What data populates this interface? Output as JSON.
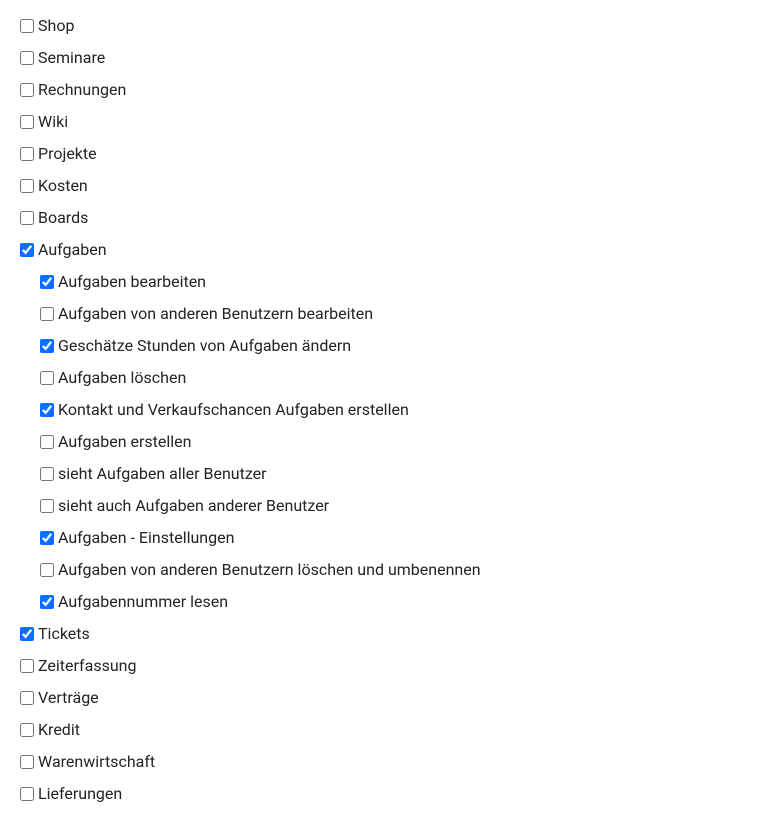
{
  "permissions": [
    {
      "id": "shop",
      "label": "Shop",
      "checked": false
    },
    {
      "id": "seminare",
      "label": "Seminare",
      "checked": false
    },
    {
      "id": "rechnungen",
      "label": "Rechnungen",
      "checked": false
    },
    {
      "id": "wiki",
      "label": "Wiki",
      "checked": false
    },
    {
      "id": "projekte",
      "label": "Projekte",
      "checked": false
    },
    {
      "id": "kosten",
      "label": "Kosten",
      "checked": false
    },
    {
      "id": "boards",
      "label": "Boards",
      "checked": false
    },
    {
      "id": "aufgaben",
      "label": "Aufgaben",
      "checked": true,
      "children": [
        {
          "id": "aufgaben-bearbeiten",
          "label": "Aufgaben bearbeiten",
          "checked": true
        },
        {
          "id": "aufgaben-andere-bearbeiten",
          "label": "Aufgaben von anderen Benutzern bearbeiten",
          "checked": false
        },
        {
          "id": "aufgaben-stunden",
          "label": "Geschätze Stunden von Aufgaben ändern",
          "checked": true
        },
        {
          "id": "aufgaben-loeschen",
          "label": "Aufgaben löschen",
          "checked": false
        },
        {
          "id": "aufgaben-kontakt",
          "label": "Kontakt und Verkaufschancen Aufgaben erstellen",
          "checked": true
        },
        {
          "id": "aufgaben-erstellen",
          "label": "Aufgaben erstellen",
          "checked": false
        },
        {
          "id": "aufgaben-sieht-alle",
          "label": "sieht Aufgaben aller Benutzer",
          "checked": false
        },
        {
          "id": "aufgaben-sieht-andere",
          "label": "sieht auch Aufgaben anderer Benutzer",
          "checked": false
        },
        {
          "id": "aufgaben-einstellungen",
          "label": "Aufgaben - Einstellungen",
          "checked": true
        },
        {
          "id": "aufgaben-andere-loeschen",
          "label": "Aufgaben von anderen Benutzern löschen und umbenennen",
          "checked": false
        },
        {
          "id": "aufgaben-nummer",
          "label": "Aufgabennummer lesen",
          "checked": true
        }
      ]
    },
    {
      "id": "tickets",
      "label": "Tickets",
      "checked": true
    },
    {
      "id": "zeiterfassung",
      "label": "Zeiterfassung",
      "checked": false
    },
    {
      "id": "vertraege",
      "label": "Verträge",
      "checked": false
    },
    {
      "id": "kredit",
      "label": "Kredit",
      "checked": false
    },
    {
      "id": "warenwirtschaft",
      "label": "Warenwirtschaft",
      "checked": false
    },
    {
      "id": "lieferungen",
      "label": "Lieferungen",
      "checked": false
    }
  ]
}
